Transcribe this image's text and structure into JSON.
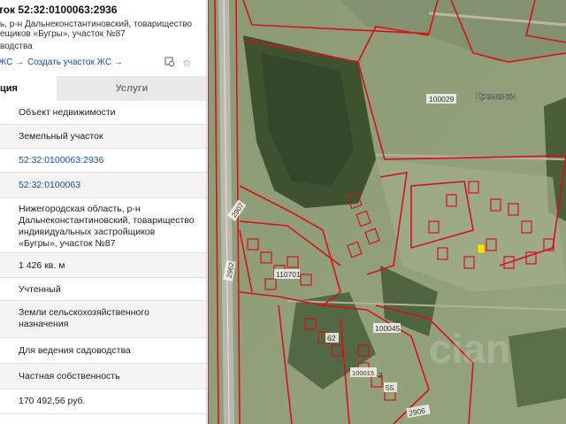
{
  "header": {
    "title": "ток 52:32:0100063:2936",
    "address_line1": "ь, р-н Дальнеконстантиновский, товарищество",
    "address_line2": "ещиков «Бугры», участок №87",
    "purpose": "водства"
  },
  "links": {
    "link1": "ЖС →",
    "link2": "Создать участок ЖС →"
  },
  "tabs": [
    {
      "label": "ция"
    },
    {
      "label": "Услуги"
    }
  ],
  "rows": [
    {
      "value": "Объект недвижимости"
    },
    {
      "value": "Земельный участок"
    },
    {
      "value": "52:32:0100063:2936"
    },
    {
      "value": "52:32:0100063"
    },
    {
      "value": "Нижегородская область, р-н Дальнеконстантиновский, товарищество индивидуальных застройщиков «Бугры», участок №87"
    },
    {
      "value": "1 426 кв. м"
    },
    {
      "value": "Учтенный"
    },
    {
      "value": "Земли сельскохозяйственного назначения"
    },
    {
      "value": "Для ведения садоводства"
    },
    {
      "value": "Частная собственность"
    },
    {
      "value": "170 492,56 руб."
    }
  ],
  "map": {
    "place_name": "Кременки",
    "labels": [
      "100029",
      "110701",
      "100045",
      "2907",
      "2962",
      "62",
      "100015",
      "55",
      "2906",
      "3"
    ],
    "watermark": "cian",
    "boundary_color": "#d8101c",
    "selected_color": "#f2e21a"
  },
  "icons": {
    "map_icon": "map-pin-icon",
    "star_icon": "star-icon"
  }
}
